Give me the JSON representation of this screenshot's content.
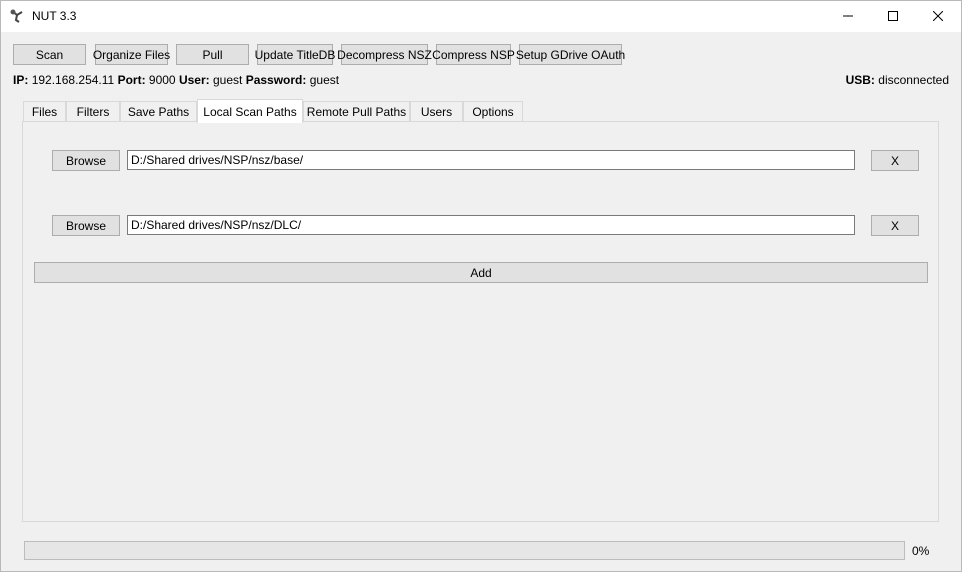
{
  "window": {
    "title": "NUT 3.3"
  },
  "toolbar": {
    "scan": "Scan",
    "organize": "Organize Files",
    "pull": "Pull",
    "update_titledb": "Update TitleDB",
    "decompress": "Decompress NSZ",
    "compress": "Compress NSP",
    "gdrive": "Setup GDrive OAuth"
  },
  "connection": {
    "ip_label": "IP:",
    "ip_value": "192.168.254.11",
    "port_label": "Port:",
    "port_value": "9000",
    "user_label": "User:",
    "user_value": "guest",
    "password_label": "Password:",
    "password_value": "guest",
    "usb_label": "USB:",
    "usb_value": "disconnected"
  },
  "tabs": [
    {
      "label": "Files"
    },
    {
      "label": "Filters"
    },
    {
      "label": "Save Paths"
    },
    {
      "label": "Local Scan Paths"
    },
    {
      "label": "Remote Pull Paths"
    },
    {
      "label": "Users"
    },
    {
      "label": "Options"
    }
  ],
  "active_tab": "Local Scan Paths",
  "scan_paths": [
    {
      "browse": "Browse",
      "path": "D:/Shared drives/NSP/nsz/base/",
      "remove": "X"
    },
    {
      "browse": "Browse",
      "path": "D:/Shared drives/NSP/nsz/DLC/",
      "remove": "X"
    }
  ],
  "add_label": "Add",
  "progress": {
    "percent": 0,
    "label": "0%"
  },
  "colors": {
    "button_bg": "#e1e1e1",
    "button_border": "#adadad",
    "window_bg": "#f0f0f0"
  }
}
